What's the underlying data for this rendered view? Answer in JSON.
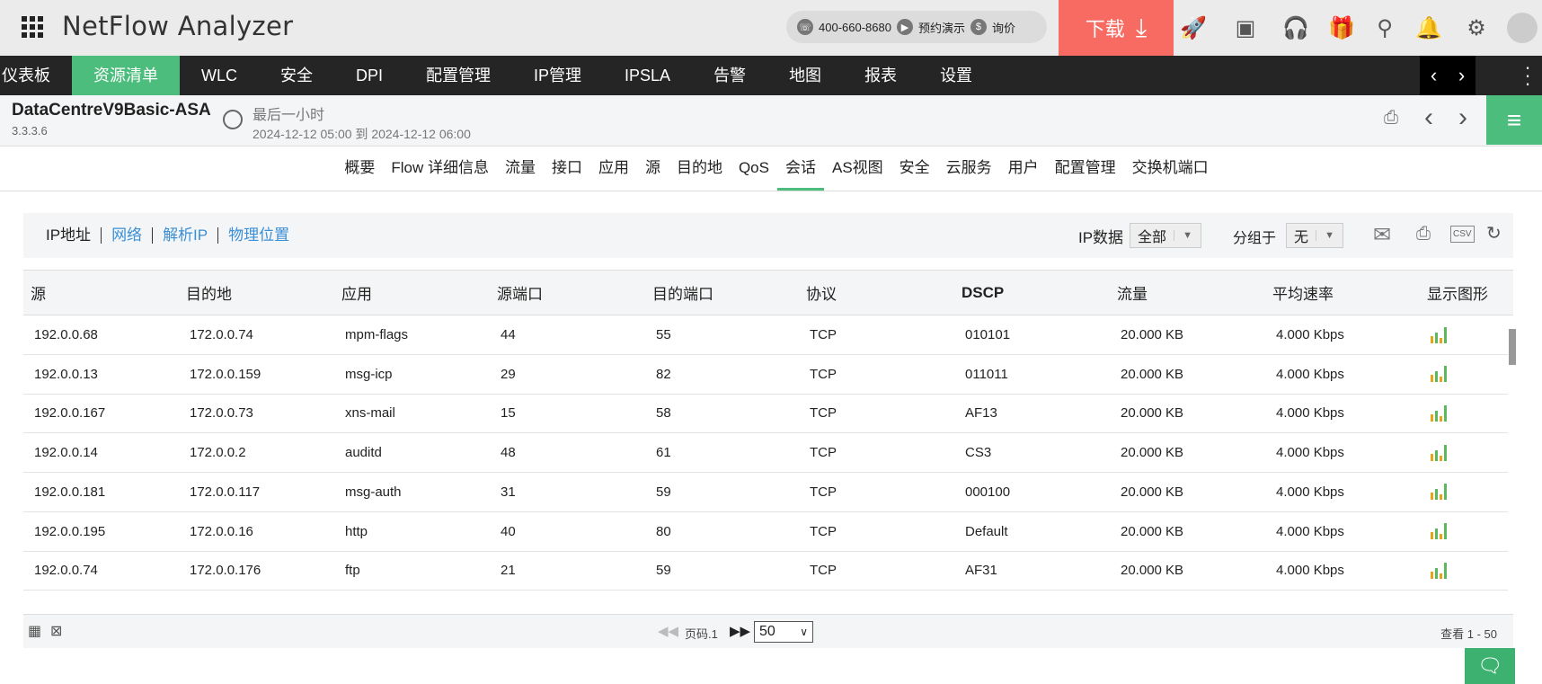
{
  "header": {
    "app_title": "NetFlow Analyzer",
    "phone": "400-660-8680",
    "demo": "预约演示",
    "price": "询价",
    "download": "下载"
  },
  "nav": {
    "items": [
      "仪表板",
      "资源清单",
      "WLC",
      "安全",
      "DPI",
      "配置管理",
      "IP管理",
      "IPSLA",
      "告警",
      "地图",
      "报表",
      "设置"
    ],
    "active": 1
  },
  "device": {
    "name": "DataCentreV9Basic-ASA",
    "ip": "3.3.3.6",
    "range_label": "最后一小时",
    "range_time": "2024-12-12 05:00 到 2024-12-12 06:00"
  },
  "subtabs": {
    "items": [
      "概要",
      "Flow 详细信息",
      "流量",
      "接口",
      "应用",
      "源",
      "目的地",
      "QoS",
      "会话",
      "AS视图",
      "安全",
      "云服务",
      "用户",
      "配置管理",
      "交换机端口"
    ],
    "active": 8
  },
  "toolbar": {
    "views": [
      "IP地址",
      "网络",
      "解析IP",
      "物理位置"
    ],
    "ip_data_label": "IP数据",
    "ip_data_value": "全部",
    "group_label": "分组于",
    "group_value": "无"
  },
  "table": {
    "columns": [
      "源",
      "目的地",
      "应用",
      "源端口",
      "目的端口",
      "协议",
      "DSCP",
      "流量",
      "平均速率",
      "显示图形"
    ],
    "rows": [
      [
        "192.0.0.68",
        "172.0.0.74",
        "mpm-flags",
        "44",
        "55",
        "TCP",
        "010101",
        "20.000 KB",
        "4.000 Kbps"
      ],
      [
        "192.0.0.13",
        "172.0.0.159",
        "msg-icp",
        "29",
        "82",
        "TCP",
        "011011",
        "20.000 KB",
        "4.000 Kbps"
      ],
      [
        "192.0.0.167",
        "172.0.0.73",
        "xns-mail",
        "15",
        "58",
        "TCP",
        "AF13",
        "20.000 KB",
        "4.000 Kbps"
      ],
      [
        "192.0.0.14",
        "172.0.0.2",
        "auditd",
        "48",
        "61",
        "TCP",
        "CS3",
        "20.000 KB",
        "4.000 Kbps"
      ],
      [
        "192.0.0.181",
        "172.0.0.117",
        "msg-auth",
        "31",
        "59",
        "TCP",
        "000100",
        "20.000 KB",
        "4.000 Kbps"
      ],
      [
        "192.0.0.195",
        "172.0.0.16",
        "http",
        "40",
        "80",
        "TCP",
        "Default",
        "20.000 KB",
        "4.000 Kbps"
      ],
      [
        "192.0.0.74",
        "172.0.0.176",
        "ftp",
        "21",
        "59",
        "TCP",
        "AF31",
        "20.000 KB",
        "4.000 Kbps"
      ]
    ]
  },
  "footer": {
    "page_label": "页码.1",
    "page_size": "50",
    "view_range": "查看 1 - 50"
  },
  "colors": {
    "accent": "#4cbd7d",
    "download": "#f76b63",
    "bar_orange": "#e8a317",
    "bar_green": "#5cb85c"
  }
}
